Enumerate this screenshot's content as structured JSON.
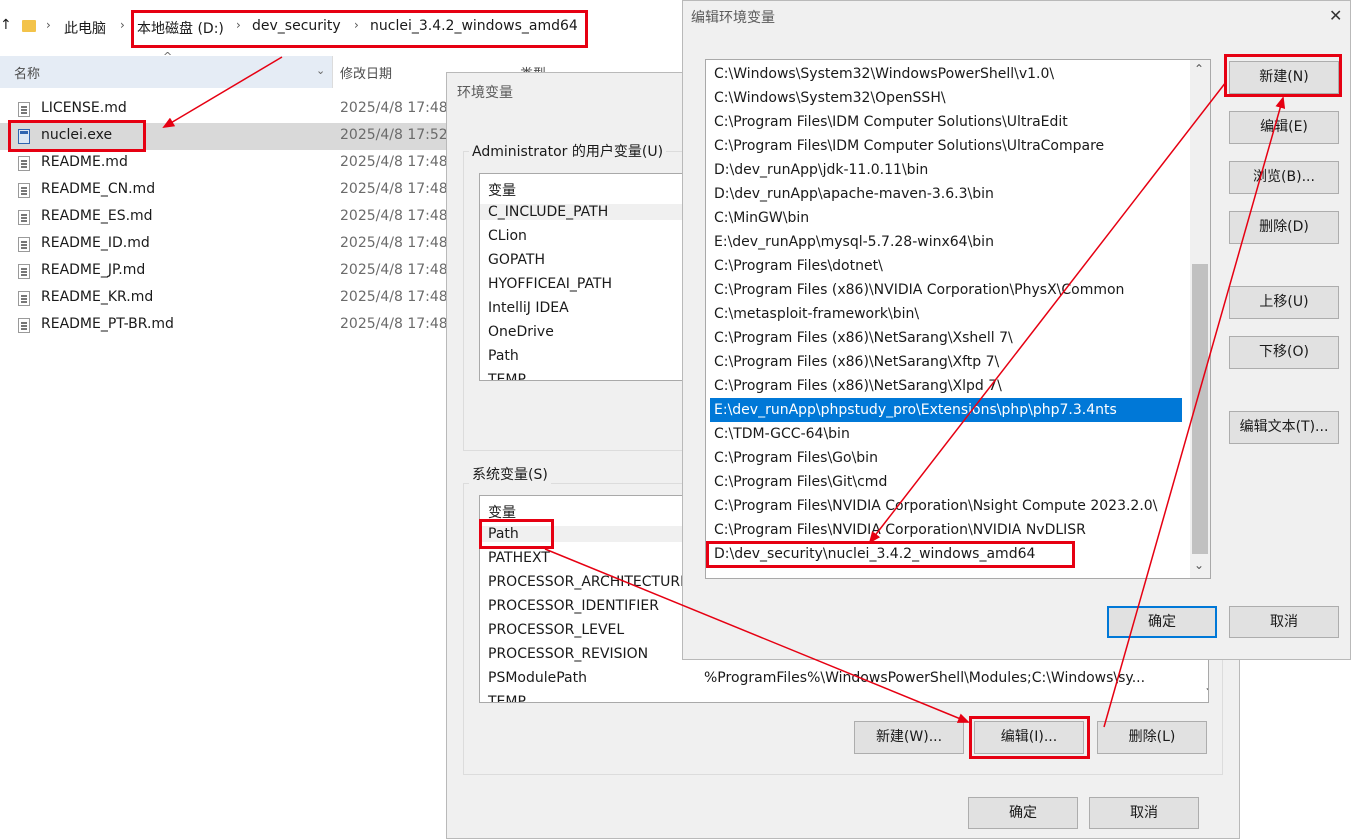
{
  "explorer": {
    "breadcrumb": [
      "此电脑",
      "本地磁盘 (D:)",
      "dev_security",
      "nuclei_3.4.2_windows_amd64"
    ],
    "columns": {
      "name": "名称",
      "date": "修改日期",
      "type": "类型"
    },
    "files": [
      {
        "name": "LICENSE.md",
        "date": "2025/4/8 17:48",
        "icon": "md-file-icon"
      },
      {
        "name": "nuclei.exe",
        "date": "2025/4/8 17:52",
        "icon": "exe-file-icon"
      },
      {
        "name": "README.md",
        "date": "2025/4/8 17:48",
        "icon": "md-file-icon"
      },
      {
        "name": "README_CN.md",
        "date": "2025/4/8 17:48",
        "icon": "md-file-icon"
      },
      {
        "name": "README_ES.md",
        "date": "2025/4/8 17:48",
        "icon": "md-file-icon"
      },
      {
        "name": "README_ID.md",
        "date": "2025/4/8 17:48",
        "icon": "md-file-icon"
      },
      {
        "name": "README_JP.md",
        "date": "2025/4/8 17:48",
        "icon": "md-file-icon"
      },
      {
        "name": "README_KR.md",
        "date": "2025/4/8 17:48",
        "icon": "md-file-icon"
      },
      {
        "name": "README_PT-BR.md",
        "date": "2025/4/8 17:48",
        "icon": "md-file-icon"
      }
    ]
  },
  "env_dialog": {
    "title": "环境变量",
    "user_group_label": "Administrator 的用户变量(U)",
    "user_header": "变量",
    "user_vars": [
      "C_INCLUDE_PATH",
      "CLion",
      "GOPATH",
      "HYOFFICEAI_PATH",
      "IntelliJ IDEA",
      "OneDrive",
      "Path",
      "TEMP"
    ],
    "system_group_label": "系统变量(S)",
    "system_header": "变量",
    "system_vars": [
      "Path",
      "PATHEXT",
      "PROCESSOR_ARCHITECTURE",
      "PROCESSOR_IDENTIFIER",
      "PROCESSOR_LEVEL",
      "PROCESSOR_REVISION",
      "PSModulePath",
      "TEMP"
    ],
    "psmodule_value": "%ProgramFiles%\\WindowsPowerShell\\Modules;C:\\Windows\\sy...",
    "buttons": {
      "new": "新建(W)...",
      "edit": "编辑(I)...",
      "delete": "删除(L)",
      "ok": "确定",
      "cancel": "取消"
    }
  },
  "edit_dialog": {
    "title": "编辑环境变量",
    "paths": [
      "C:\\Windows\\System32\\WindowsPowerShell\\v1.0\\",
      "C:\\Windows\\System32\\OpenSSH\\",
      "C:\\Program Files\\IDM Computer Solutions\\UltraEdit",
      "C:\\Program Files\\IDM Computer Solutions\\UltraCompare",
      "D:\\dev_runApp\\jdk-11.0.11\\bin",
      "D:\\dev_runApp\\apache-maven-3.6.3\\bin",
      "C:\\MinGW\\bin",
      "E:\\dev_runApp\\mysql-5.7.28-winx64\\bin",
      "C:\\Program Files\\dotnet\\",
      "C:\\Program Files (x86)\\NVIDIA Corporation\\PhysX\\Common",
      "C:\\metasploit-framework\\bin\\",
      "C:\\Program Files (x86)\\NetSarang\\Xshell 7\\",
      "C:\\Program Files (x86)\\NetSarang\\Xftp 7\\",
      "C:\\Program Files (x86)\\NetSarang\\Xlpd 7\\",
      "E:\\dev_runApp\\phpstudy_pro\\Extensions\\php\\php7.3.4nts",
      "C:\\TDM-GCC-64\\bin",
      "C:\\Program Files\\Go\\bin",
      "C:\\Program Files\\Git\\cmd",
      "C:\\Program Files\\NVIDIA Corporation\\Nsight Compute 2023.2.0\\",
      "C:\\Program Files\\NVIDIA Corporation\\NVIDIA NvDLISR",
      "D:\\dev_security\\nuclei_3.4.2_windows_amd64"
    ],
    "selected_index": 14,
    "buttons": {
      "new": "新建(N)",
      "edit": "编辑(E)",
      "browse": "浏览(B)...",
      "delete": "删除(D)",
      "up": "上移(U)",
      "down": "下移(O)",
      "edit_text": "编辑文本(T)...",
      "ok": "确定",
      "cancel": "取消"
    },
    "close_glyph": "✕"
  },
  "colors": {
    "annotation": "#e60012",
    "selection": "#0078d7"
  }
}
